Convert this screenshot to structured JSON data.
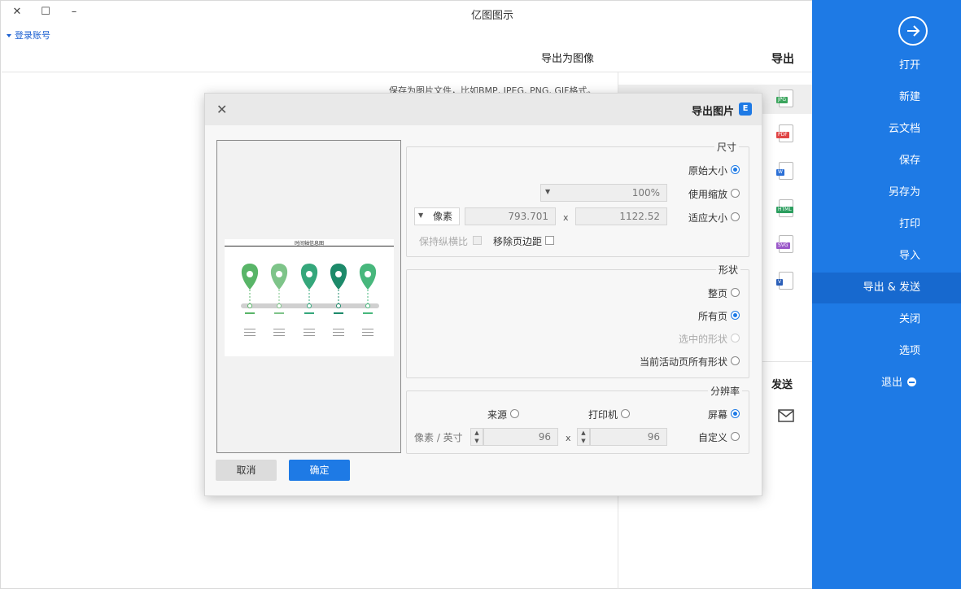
{
  "window": {
    "title": "亿图图示",
    "login": "登录账号"
  },
  "sidebar": {
    "items": [
      {
        "label": "打开"
      },
      {
        "label": "新建"
      },
      {
        "label": "云文档"
      },
      {
        "label": "保存"
      },
      {
        "label": "另存为"
      },
      {
        "label": "打印"
      },
      {
        "label": "导入"
      },
      {
        "label": "导出 & 发送"
      },
      {
        "label": "关闭"
      },
      {
        "label": "选项"
      },
      {
        "label": "退出"
      }
    ]
  },
  "export_panel": {
    "export_title": "导出",
    "send_title": "发送",
    "formats": [
      "JPG",
      "PDF",
      "W",
      "HTML",
      "SVG",
      "V"
    ]
  },
  "main": {
    "section_title": "导出为图像",
    "description": "保存为图片文件，比如BMP, JPEG, PNG, GIF格式。"
  },
  "dialog": {
    "title": "导出图片",
    "size": {
      "label": "尺寸",
      "original": "原始大小",
      "use_zoom": "使用缩放",
      "zoom_value": "100%",
      "fit": "适应大小",
      "width": "1122.52",
      "height": "793.701",
      "unit": "像素",
      "remove_margin": "移除页边距",
      "keep_ratio": "保持纵横比"
    },
    "shape": {
      "label": "形状",
      "whole_page": "整页",
      "all_pages": "所有页",
      "selected": "选中的形状",
      "current_page_shapes": "当前活动页所有形状"
    },
    "resolution": {
      "label": "分辨率",
      "screen": "屏幕",
      "printer": "打印机",
      "source": "来源",
      "custom": "自定义",
      "dpi_x": "96",
      "dpi_y": "96",
      "unit": "像素 / 英寸"
    },
    "ok": "确定",
    "cancel": "取消",
    "preview_title": "时间轴信息图"
  },
  "colors": {
    "accent": "#1e7ae5",
    "sidebar_active": "#1769cf",
    "pins": [
      "#47b77c",
      "#1d8a6a",
      "#35a77b",
      "#7ec489",
      "#59b568"
    ]
  }
}
